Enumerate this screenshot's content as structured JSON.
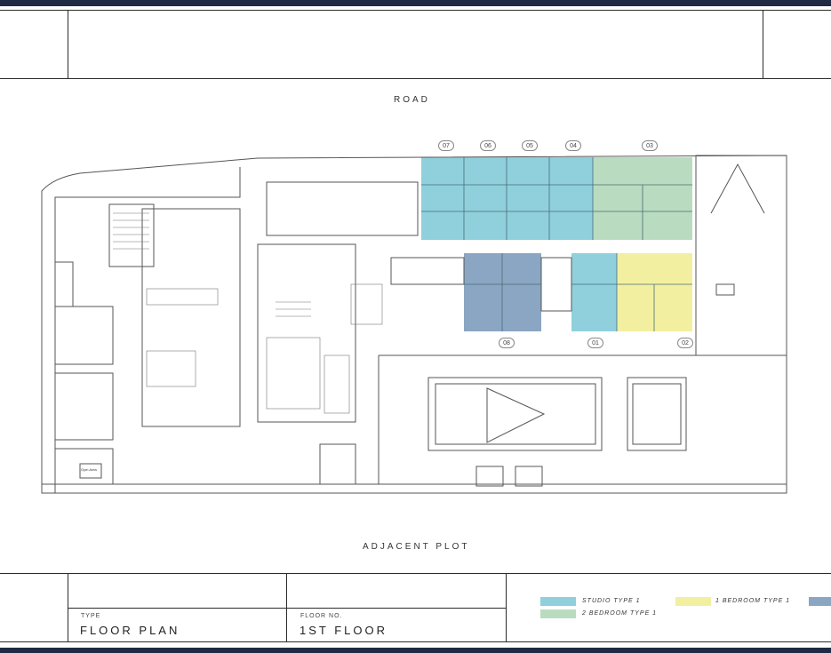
{
  "plan": {
    "road_label": "ROAD",
    "adjacent_label": "ADJACENT PLOT",
    "gym_sign": "Gym Area"
  },
  "units": [
    {
      "no": "07",
      "type": "studio"
    },
    {
      "no": "06",
      "type": "studio"
    },
    {
      "no": "05",
      "type": "studio"
    },
    {
      "no": "04",
      "type": "studio"
    },
    {
      "no": "03",
      "type": "2bed"
    },
    {
      "no": "08",
      "type": "other"
    },
    {
      "no": "01",
      "type": "studio"
    },
    {
      "no": "02",
      "type": "1bed"
    }
  ],
  "title_block": {
    "type_caption": "TYPE",
    "type_value": "FLOOR PLAN",
    "floor_caption": "FLOOR NO.",
    "floor_value": "1ST FLOOR"
  },
  "legend": [
    {
      "label": "STUDIO TYPE 1",
      "color": "#8fd0dc"
    },
    {
      "label": "2 BEDROOM TYPE 1",
      "color": "#b9dcc0"
    },
    {
      "label": "1 BEDROOM TYPE 1",
      "color": "#f2f0a0"
    },
    {
      "label": "",
      "color": "#8aa6c2"
    }
  ],
  "colors": {
    "studio": "#8fd0dc",
    "two_bed": "#b9dcc0",
    "one_bed": "#f2f0a0",
    "other": "#8aa6c2",
    "frame_bar": "#1f2a44"
  }
}
